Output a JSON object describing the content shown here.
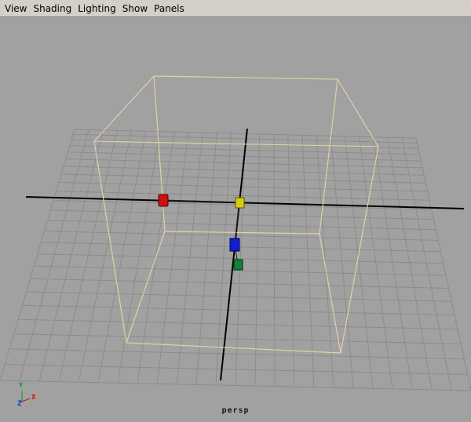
{
  "menu": {
    "items": [
      "View",
      "Shading",
      "Lighting",
      "Show",
      "Panels"
    ]
  },
  "viewport": {
    "camera": "persp",
    "axis_labels": {
      "y": "Y",
      "x": "X",
      "z": "Z"
    }
  },
  "colors": {
    "background": "#a1a1a1",
    "grid": "#8a8a8a",
    "grid_axis": "#000000",
    "bounding_box": "#e6d2a8",
    "manipulator_x": "#d01010",
    "manipulator_y": "#d8d010",
    "manipulator_z": "#1020d0",
    "manipulator_center": "#108040"
  }
}
